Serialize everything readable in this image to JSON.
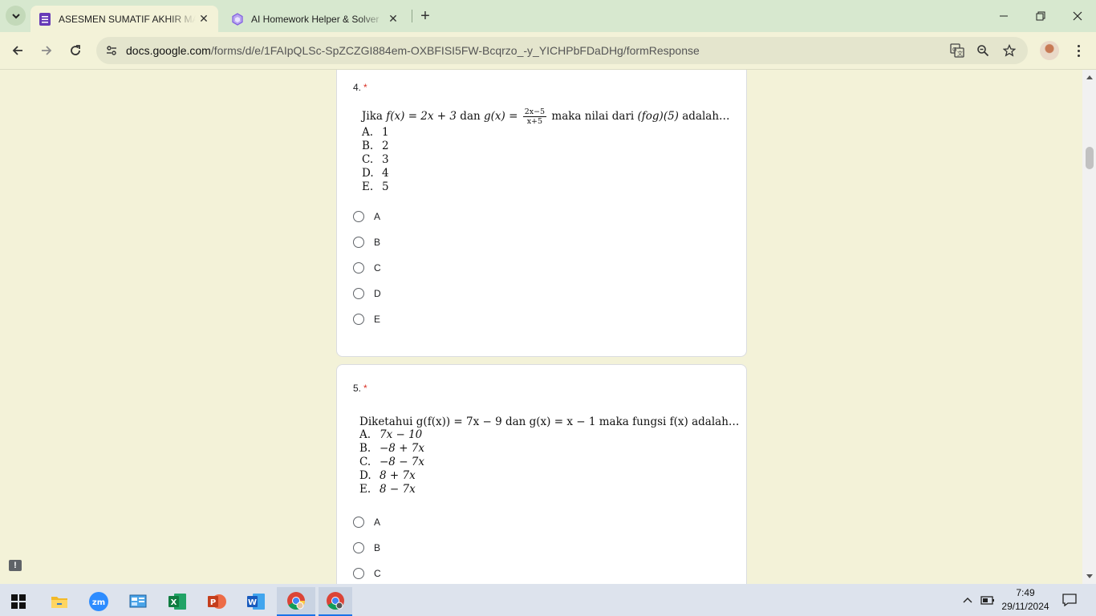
{
  "browser": {
    "tabs": [
      {
        "title": "ASESMEN SUMATIF AKHIR MATEMATIKA",
        "icon": "google-forms-icon",
        "active": true
      },
      {
        "title": "AI Homework Helper & Solver",
        "icon": "ai-helper-icon",
        "active": false
      }
    ],
    "url_host": "docs.google.com",
    "url_path": "/forms/d/e/1FAIpQLSc-SpZCZGI884em-OXBFISI5FW-Bcqrzo_-y_YICHPbFDaDHg/formResponse"
  },
  "form": {
    "questions": [
      {
        "number": "4.",
        "required_mark": "*",
        "stem_prefix": "Jika",
        "stem_fx": "f(x) = 2x + 3",
        "stem_dan": "dan",
        "stem_gx_lhs": "g(x) =",
        "frac_num": "2x−5",
        "frac_den": "x+5",
        "stem_suffix": "maka nilai dari",
        "stem_expr": "(fog)(5)",
        "stem_end": "adalah…",
        "options": [
          {
            "letter": "A.",
            "value": "1"
          },
          {
            "letter": "B.",
            "value": "2"
          },
          {
            "letter": "C.",
            "value": "3"
          },
          {
            "letter": "D.",
            "value": "4"
          },
          {
            "letter": "E.",
            "value": "5"
          }
        ],
        "choices": [
          "A",
          "B",
          "C",
          "D",
          "E"
        ]
      },
      {
        "number": "5.",
        "required_mark": "*",
        "stem": "Diketahui g(f(x)) = 7x − 9 dan g(x) = x − 1 maka fungsi f(x) adalah…",
        "options": [
          {
            "letter": "A.",
            "value": "7x − 10"
          },
          {
            "letter": "B.",
            "value": "−8 + 7x"
          },
          {
            "letter": "C.",
            "value": "−8 − 7x"
          },
          {
            "letter": "D.",
            "value": "8 + 7x"
          },
          {
            "letter": "E.",
            "value": "8 − 7x"
          }
        ],
        "choices": [
          "A",
          "B",
          "C"
        ]
      }
    ]
  },
  "taskbar": {
    "time": "7:49",
    "date": "29/11/2024"
  }
}
